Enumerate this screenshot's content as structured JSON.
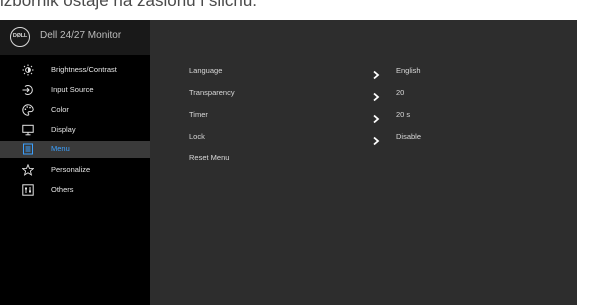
{
  "caption": "izbornik ostaje na zaslonu i sličnu.",
  "brand": {
    "logo_text": "DØLL",
    "title": "Dell 24/27 Monitor"
  },
  "sidebar": {
    "items": [
      {
        "label": "Brightness/Contrast",
        "icon": "sun-icon"
      },
      {
        "label": "Input Source",
        "icon": "input-source-icon"
      },
      {
        "label": "Color",
        "icon": "color-palette-icon"
      },
      {
        "label": "Display",
        "icon": "display-monitor-icon"
      },
      {
        "label": "Menu",
        "icon": "menu-icon",
        "active": true
      },
      {
        "label": "Personalize",
        "icon": "star-icon"
      },
      {
        "label": "Others",
        "icon": "others-icon"
      }
    ]
  },
  "menu_settings": {
    "rows": [
      {
        "label": "Language",
        "value": "English"
      },
      {
        "label": "Transparency",
        "value": "20"
      },
      {
        "label": "Timer",
        "value": "20 s"
      },
      {
        "label": "Lock",
        "value": "Disable"
      },
      {
        "label": "Reset Menu",
        "value": ""
      }
    ]
  },
  "colors": {
    "accent": "#3aa0ff",
    "panel": "#2d2d2d",
    "sidebar": "#000000",
    "highlight": "#3a3a3a"
  }
}
